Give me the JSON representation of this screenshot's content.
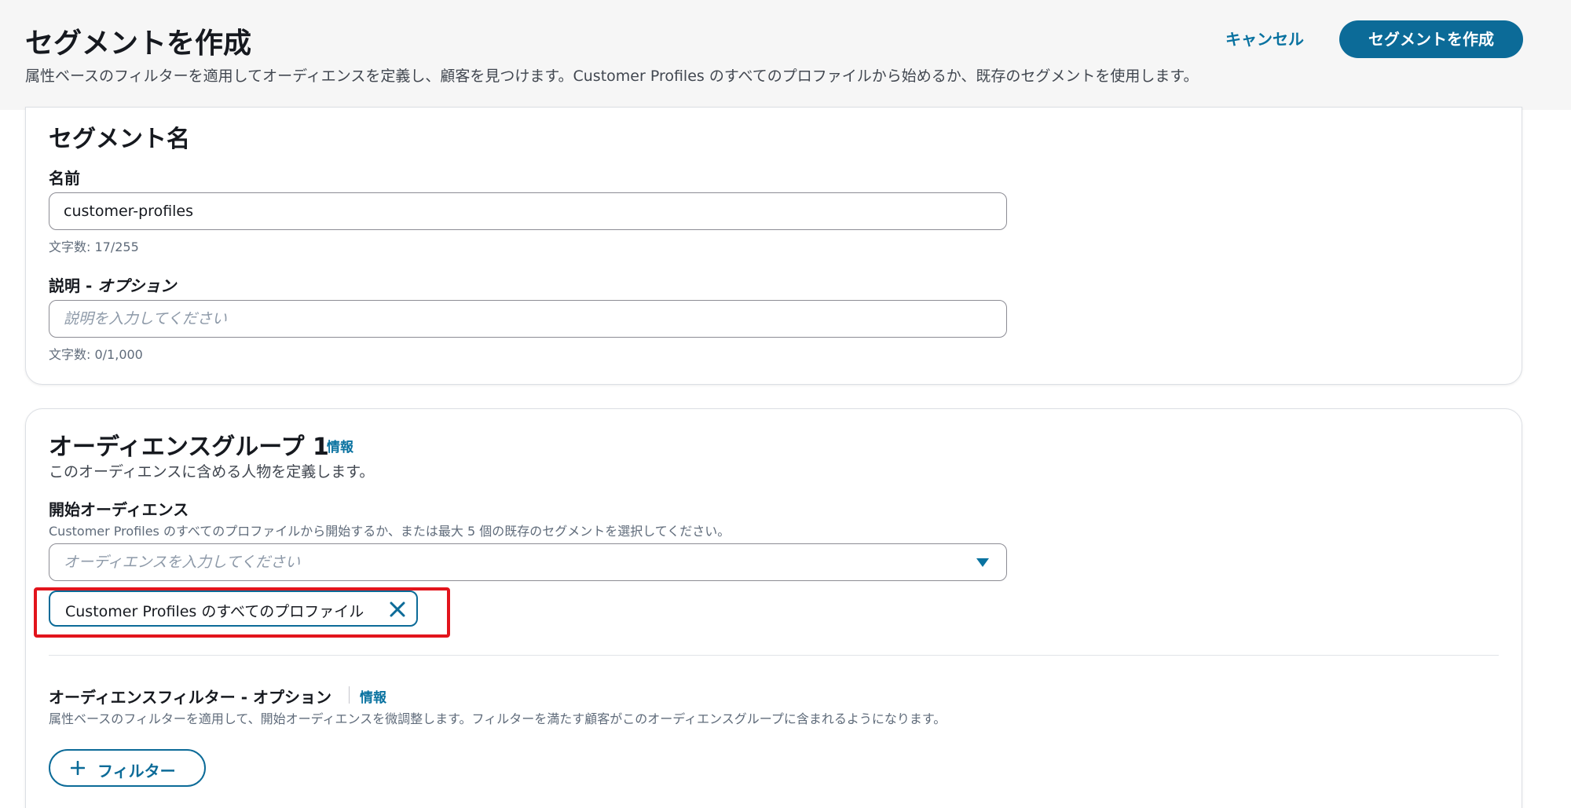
{
  "header": {
    "title": "セグメントを作成",
    "description": "属性ベースのフィルターを適用してオーディエンスを定義し、顧客を見つけます。Customer Profiles のすべてのプロファイルから始めるか、既存のセグメントを使用します。",
    "cancel_label": "キャンセル",
    "create_label": "セグメントを作成"
  },
  "segment_name_card": {
    "heading": "セグメント名",
    "name_label": "名前",
    "name_value": "customer-profiles",
    "name_count": "文字数: 17/255",
    "desc_label_main": "説明 - ",
    "desc_label_opt": "オプション",
    "desc_placeholder": "説明を入力してください",
    "desc_count": "文字数: 0/1,000"
  },
  "audience_group_card": {
    "heading": "オーディエンスグループ 1",
    "info_label": "情報",
    "subtitle": "このオーディエンスに含める人物を定義します。",
    "start_label": "開始オーディエンス",
    "start_hint": "Customer Profiles のすべてのプロファイルから開始するか、または最大 5 個の既存のセグメントを選択してください。",
    "start_placeholder": "オーディエンスを入力してください",
    "selected_token": "Customer Profiles のすべてのプロファイル",
    "filter_label": "オーディエンスフィルター - オプション",
    "filter_info_label": "情報",
    "filter_hint": "属性ベースのフィルターを適用して、開始オーディエンスを微調整します。フィルターを満たす顧客がこのオーディエンスグループに含まれるようになります。",
    "add_filter_label": "フィルター"
  },
  "colors": {
    "accent": "#0c6b98",
    "link": "#0972a0",
    "highlight": "#e2141c"
  }
}
